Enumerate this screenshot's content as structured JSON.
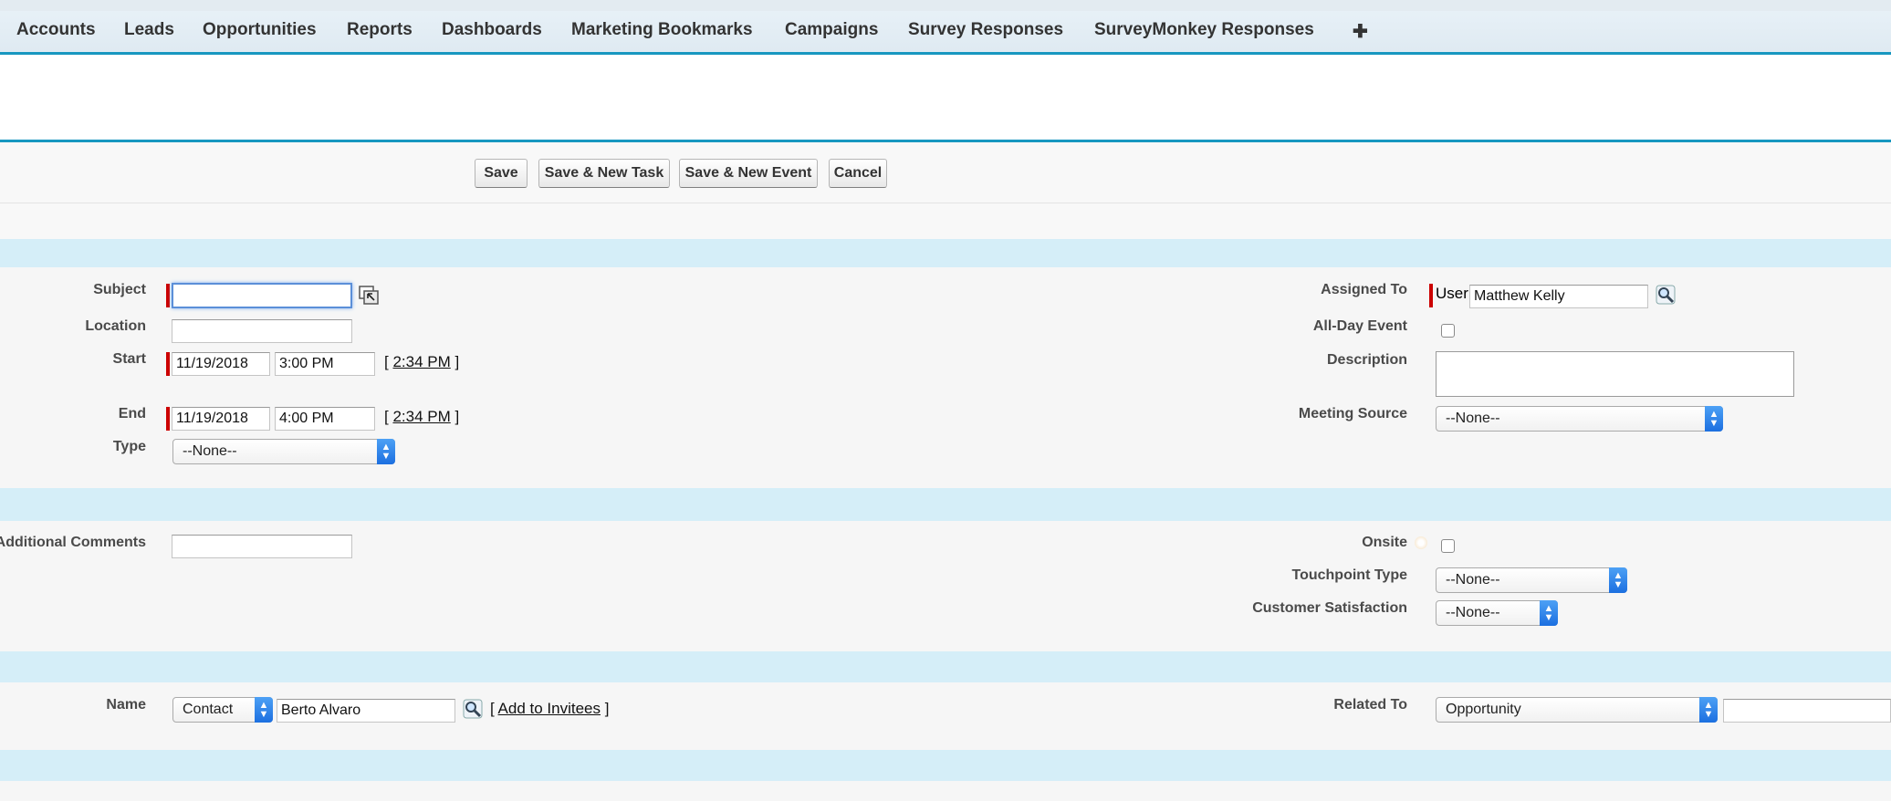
{
  "nav": {
    "tabs": [
      "Accounts",
      "Leads",
      "Opportunities",
      "Reports",
      "Dashboards",
      "Marketing Bookmarks",
      "Campaigns",
      "Survey Responses",
      "SurveyMonkey Responses"
    ],
    "plus": "✚"
  },
  "toolbar": {
    "save": "Save",
    "save_new_task": "Save & New Task",
    "save_new_event": "Save & New Event",
    "cancel": "Cancel"
  },
  "details": {
    "subject": {
      "label": "Subject",
      "value": ""
    },
    "location": {
      "label": "Location",
      "value": ""
    },
    "start": {
      "label": "Start",
      "date": "11/19/2018",
      "time": "3:00 PM",
      "now_link": "2:34 PM"
    },
    "end": {
      "label": "End",
      "date": "11/19/2018",
      "time": "4:00 PM",
      "now_link": "2:34 PM"
    },
    "type": {
      "label": "Type",
      "value": "--None--"
    },
    "assigned_to": {
      "label": "Assigned To",
      "kind": "User",
      "value": "Matthew Kelly"
    },
    "all_day": {
      "label": "All-Day Event",
      "checked": false
    },
    "description": {
      "label": "Description",
      "value": ""
    },
    "meeting_source": {
      "label": "Meeting Source",
      "value": "--None--"
    }
  },
  "extra": {
    "additional_comments": {
      "label": "Additional Comments",
      "value": ""
    },
    "onsite": {
      "label": "Onsite",
      "checked": false
    },
    "touchpoint_type": {
      "label": "Touchpoint Type",
      "value": "--None--"
    },
    "customer_satisfaction": {
      "label": "Customer Satisfaction",
      "value": "--None--"
    }
  },
  "related": {
    "name": {
      "label": "Name",
      "type": "Contact",
      "value": "Berto Alvaro",
      "invitees_link": "Add to Invitees"
    },
    "related_to": {
      "label": "Related To",
      "type": "Opportunity",
      "value": ""
    }
  },
  "brackets": {
    "open": "[",
    "close": "]"
  },
  "colors": {
    "accent": "#1797c0",
    "band": "#d5eef8",
    "required": "#cc0000",
    "select_arrow": "#1c6fe0"
  }
}
